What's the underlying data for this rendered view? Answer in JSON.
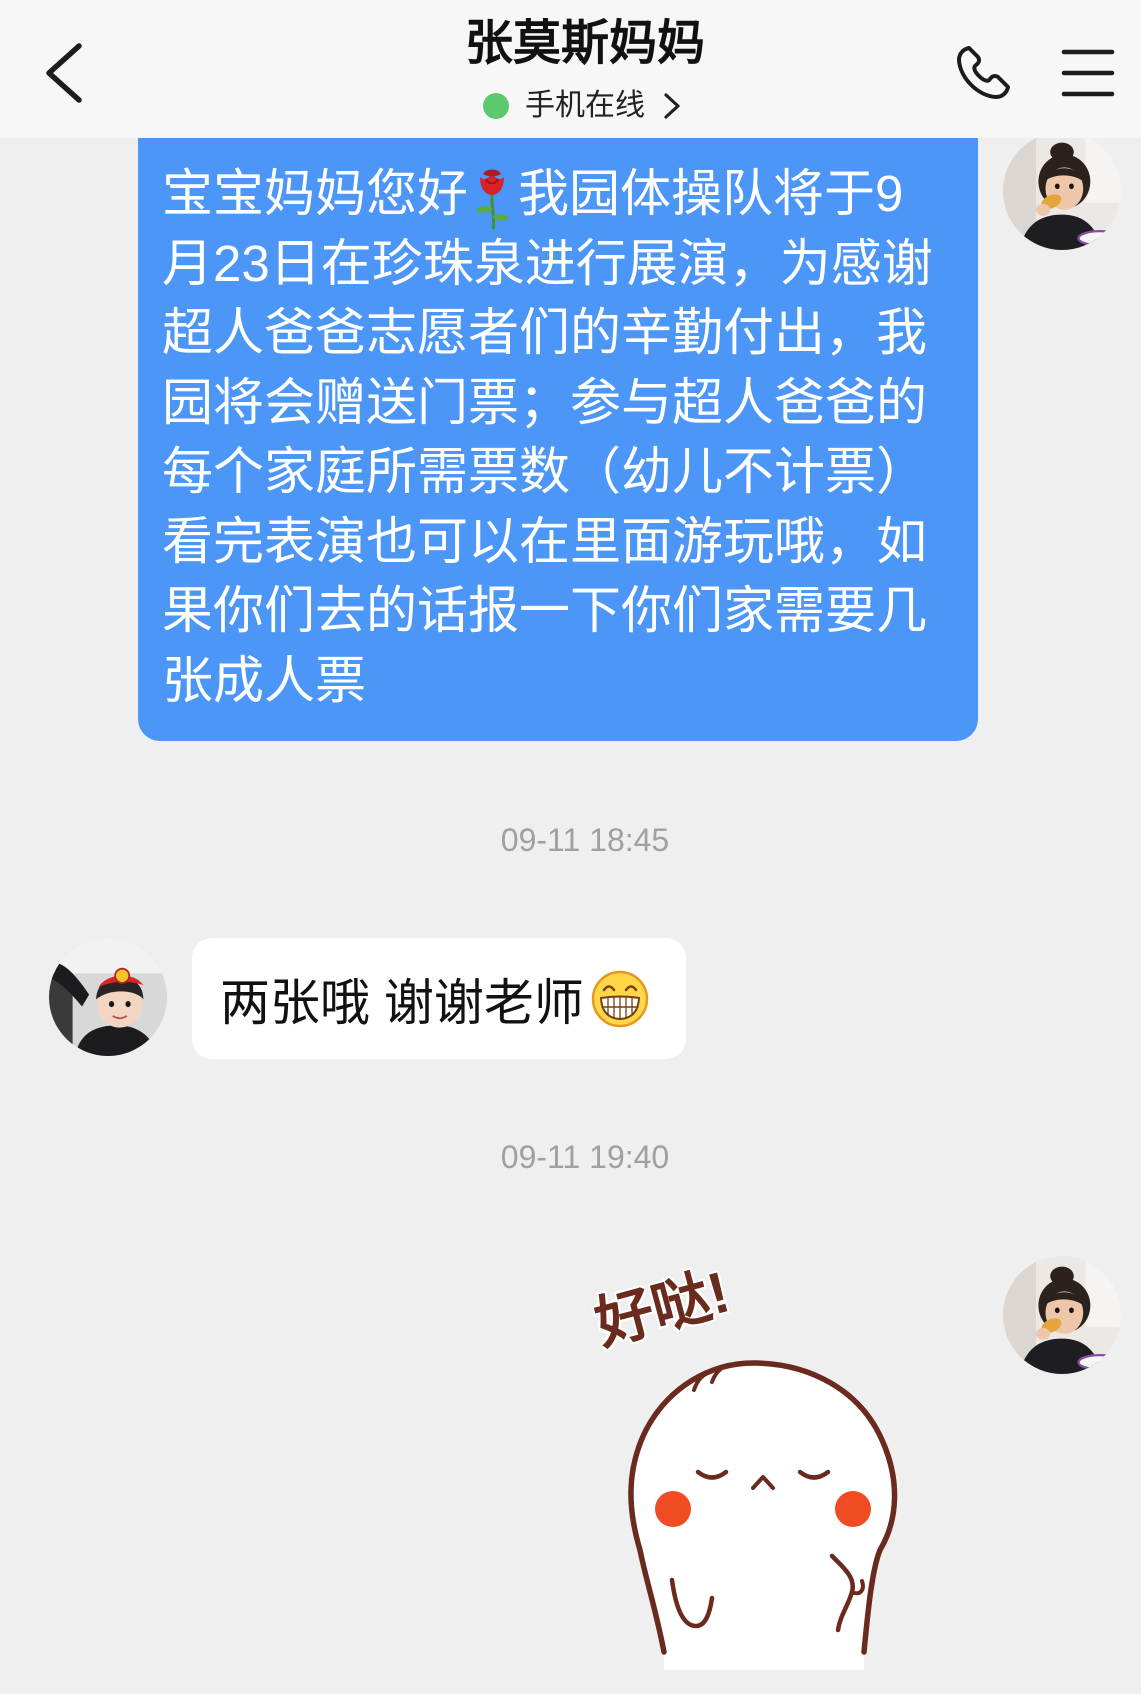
{
  "header": {
    "title": "张莫斯妈妈",
    "status_text": "手机在线",
    "back_icon": "chevron-left-icon",
    "status_chevron_icon": "chevron-right-icon",
    "call_icon": "phone-icon",
    "menu_icon": "menu-icon"
  },
  "colors": {
    "chat_background": "#efeff0",
    "header_background": "#f7f7f7",
    "outgoing_bubble": "#4b96f6",
    "incoming_bubble": "#ffffff",
    "timestamp_text": "#a0a0a2",
    "online_dot": "#5cc96c",
    "sticker_ink": "#6b2a1e",
    "sticker_cheek": "#f04b23"
  },
  "chat": {
    "message_1": {
      "first_line": {
        "before": "宝宝妈妈您好",
        "emoji": "rose-emoji-icon",
        "after": "我园体操队将于9"
      },
      "lines": [
        "月23日在珍珠泉进行展演，为感谢",
        "超人爸爸志愿者们的辛勤付出，我",
        "园将会赠送门票；参与超人爸爸的",
        "每个家庭所需票数（幼儿不计票）",
        "看完表演也可以在里面游玩哦，如",
        "果你们去的话报一下你们家需要几",
        "张成人票"
      ]
    },
    "timestamp_1": "09-11 18:45",
    "message_2": {
      "text": "两张哦 谢谢老师",
      "emoji": "grin-emoji-icon"
    },
    "timestamp_2": "09-11 19:40",
    "message_3_sticker": {
      "lettering": "好哒!"
    }
  }
}
